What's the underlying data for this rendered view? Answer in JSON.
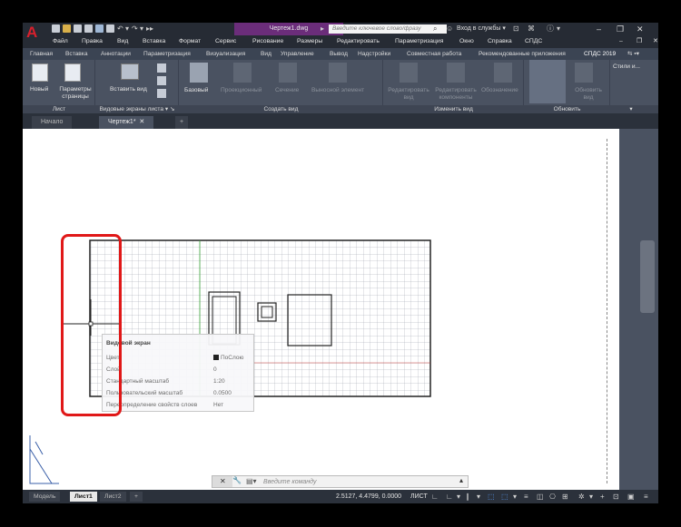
{
  "window": {
    "title": "Чертеж1.dwg",
    "search_placeholder": "Введите ключевое слово/фразу",
    "login_label": "Вход в службы"
  },
  "menu": [
    "Файл",
    "Правка",
    "Вид",
    "Вставка",
    "Формат",
    "Сервис",
    "Рисование",
    "Размеры",
    "Редактировать",
    "Параметризация",
    "Окно",
    "Справка",
    "СПДС"
  ],
  "ribbon_tabs": [
    "Главная",
    "Вставка",
    "Аннотации",
    "Параметризация",
    "Визуализация",
    "Вид",
    "Управление",
    "Вывод",
    "Надстройки",
    "Совместная работа",
    "Рекомендованные приложения",
    "СПДС 2019"
  ],
  "ribbon": {
    "new_label": "Новый",
    "page_params_label": "Параметры страницы",
    "insert_view_label": "Вставить вид",
    "base_label": "Базовый",
    "projected_label": "Проекционный",
    "section_label": "Сечение",
    "detail_label": "Выносной элемент",
    "edit_view_label": "Редактировать вид",
    "edit_components_label": "Редактировать компоненты",
    "symbol_label": "Обозначение",
    "update_label": "Обновить вид",
    "styles_label": "Стили и..."
  },
  "ribbon_groups": [
    "Лист",
    "Видовые экраны листа",
    "Создать вид",
    "Изменить вид",
    "Обновить"
  ],
  "doc_tabs": [
    "Начало",
    "Чертеж1*"
  ],
  "tooltip": {
    "title": "Видовой экран",
    "rows": [
      {
        "label": "Цвет",
        "value": "ПоСлою"
      },
      {
        "label": "Слой",
        "value": "0"
      },
      {
        "label": "Стандартный масштаб",
        "value": "1:20"
      },
      {
        "label": "Пользовательский масштаб",
        "value": "0.0500"
      },
      {
        "label": "Переопределение свойств слоев",
        "value": "Нет"
      }
    ]
  },
  "command_line": {
    "placeholder": "Введите  команду"
  },
  "status": {
    "layout_tabs": [
      "Модель",
      "Лист1",
      "Лист2"
    ],
    "coords": "2.5127, 4.4799, 0.0000",
    "mode": "ЛИСТ"
  },
  "colors": {
    "title_accent": "#6b2d7a",
    "highlight": "#e01818",
    "autocad_red": "#d8202c"
  }
}
